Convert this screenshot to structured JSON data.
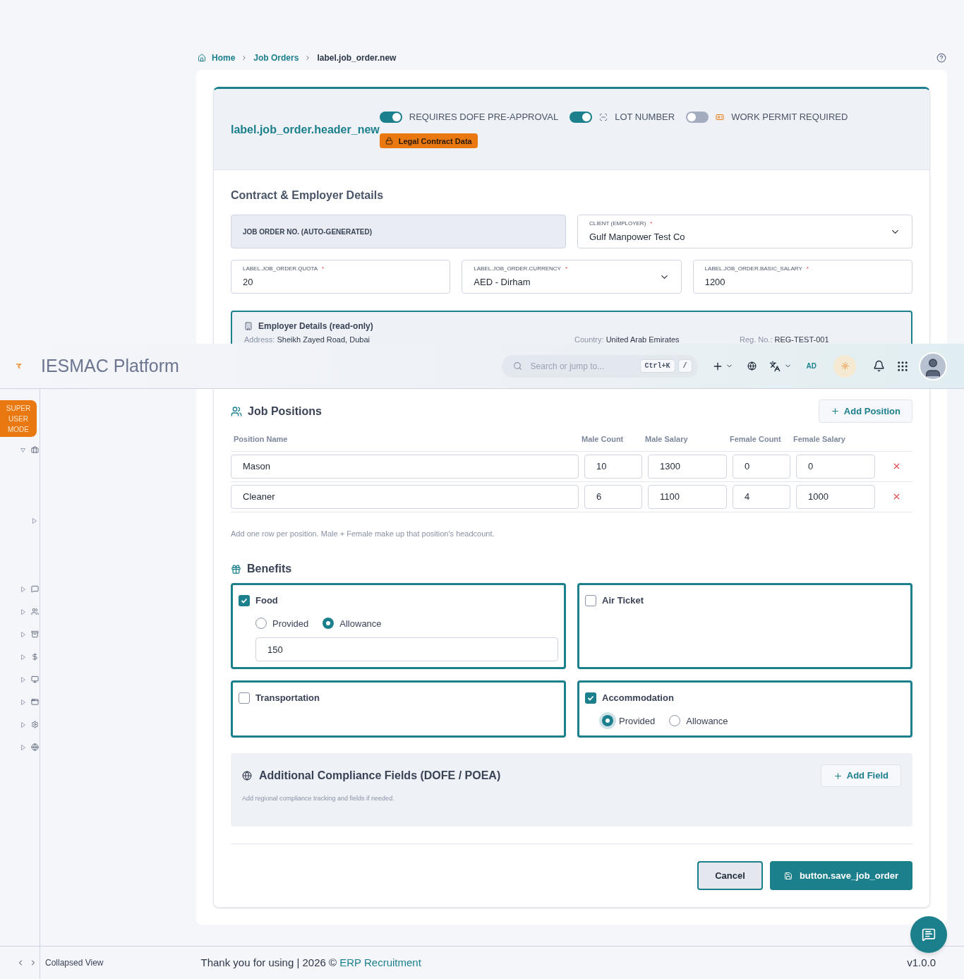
{
  "breadcrumb": [
    {
      "label": "Home",
      "link": true
    },
    {
      "label": "Job Orders",
      "link": true
    },
    {
      "label": "label.job_order.new",
      "link": false
    }
  ],
  "form_header": {
    "title": "label.job_order.header_new",
    "toggles": [
      {
        "label": "REQUIRES DOFE PRE-APPROVAL",
        "on": true
      },
      {
        "label": "LOT NUMBER",
        "on": true
      },
      {
        "label": "WORK PERMIT REQUIRED",
        "on": false
      }
    ],
    "badge": "Legal Contract Data"
  },
  "contract": {
    "title": "Contract & Employer Details",
    "rows": [
      [
        {
          "kind": "readonly",
          "label": "JOB ORDER NO. (AUTO-GENERATED)"
        },
        {
          "kind": "select",
          "label": "CLIENT (EMPLOYER)",
          "required_mark": "*",
          "value": "Gulf Manpower Test Co"
        }
      ],
      [
        {
          "kind": "text",
          "label": "LABEL.JOB_ORDER.QUOTA",
          "required_mark": "*",
          "value": "20"
        },
        {
          "kind": "select",
          "label": "LABEL.JOB_ORDER.CURRENCY",
          "required_mark": "*",
          "value": "AED - Dirham"
        },
        {
          "kind": "text",
          "label": "LABEL.JOB_ORDER.BASIC_SALARY",
          "required_mark": "*",
          "value": "1200"
        }
      ]
    ],
    "employer": {
      "title": "Employer Details (read-only)",
      "items": [
        {
          "label": "Address:",
          "value": "Sheikh Zayed Road, Dubai"
        },
        {
          "label": "Country:",
          "value": "United Arab Emirates"
        },
        {
          "label": "Reg. No.:",
          "value": "REG-TEST-001"
        }
      ]
    }
  },
  "topbar": {
    "title": "IESMAC Platform",
    "search_placeholder": "Search or jump to...",
    "shortcuts": [
      "Ctrl+K",
      "/"
    ],
    "user_initials": "AD"
  },
  "sidebar": {
    "badge": "SUPER USER MODE",
    "items": [
      {
        "expanded": true,
        "children": [
          {
            "expanded": false
          }
        ]
      },
      {
        "expanded": false
      },
      {
        "expanded": false
      },
      {
        "expanded": false
      },
      {
        "expanded": false
      },
      {
        "expanded": false
      },
      {
        "expanded": false
      },
      {
        "expanded": false
      },
      {
        "expanded": false
      }
    ]
  },
  "positions": {
    "title": "Job Positions",
    "add_button": "Add Position",
    "columns": [
      "Position Name",
      "Male Count",
      "Male Salary",
      "Female Count",
      "Female Salary"
    ],
    "rows": [
      [
        "Mason",
        "10",
        "1300",
        "0",
        "0"
      ],
      [
        "Cleaner",
        "6",
        "1100",
        "4",
        "1000"
      ]
    ],
    "hint": "Add one row per position. Male + Female make up that position's headcount."
  },
  "benefits": {
    "title": "Benefits",
    "items": [
      {
        "label": "Food",
        "checked": true,
        "options": [
          {
            "label": "Provided",
            "selected": false
          },
          {
            "label": "Allowance",
            "selected": true
          }
        ],
        "amount": "150"
      },
      {
        "label": "Air Ticket",
        "checked": false
      },
      {
        "label": "Transportation",
        "checked": false
      },
      {
        "label": "Accommodation",
        "checked": true,
        "options": [
          {
            "label": "Provided",
            "selected": true
          },
          {
            "label": "Allowance",
            "selected": false
          }
        ]
      }
    ]
  },
  "compliance": {
    "title": "Additional Compliance Fields (DOFE / POEA)",
    "add_button": "Add Field",
    "hint": "Add regional compliance tracking and fields if needed."
  },
  "actions": {
    "cancel": "Cancel",
    "save": "button.save_job_order"
  },
  "footer": {
    "collapse_label": "Collapsed View",
    "text": "Thank you for using | 2026 ©",
    "link": "ERP Recruitment",
    "version": "v1.0.0"
  }
}
